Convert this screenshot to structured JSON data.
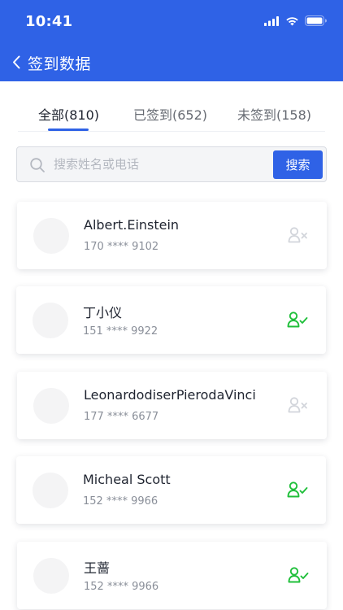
{
  "status_bar": {
    "time": "10:41"
  },
  "nav": {
    "title": "签到数据"
  },
  "tabs": [
    {
      "label": "全部(810)",
      "active": true
    },
    {
      "label": "已签到(652)",
      "active": false
    },
    {
      "label": "未签到(158)",
      "active": false
    }
  ],
  "search": {
    "placeholder": "搜索姓名或电话",
    "value": "",
    "button_label": "搜索"
  },
  "attendees": [
    {
      "name": "Albert.Einstein",
      "phone": "170 **** 9102",
      "status_icon": "user-x-icon",
      "signed_in": false
    },
    {
      "name": "丁小仪",
      "phone": "151 **** 9922",
      "status_icon": "user-check-icon",
      "signed_in": true
    },
    {
      "name": "LeonardodiserPierodaVinci",
      "phone": "177 **** 6677",
      "status_icon": "user-x-icon",
      "signed_in": false
    },
    {
      "name": "Micheal Scott",
      "phone": "152 **** 9966",
      "status_icon": "user-check-icon",
      "signed_in": true
    },
    {
      "name": "王蔷",
      "phone": "152 **** 9966",
      "status_icon": "user-check-icon",
      "signed_in": true
    }
  ],
  "colors": {
    "brand": "#2f62e6",
    "signed_in": "#1fbf3a",
    "not_signed_in": "#d2d5db"
  }
}
